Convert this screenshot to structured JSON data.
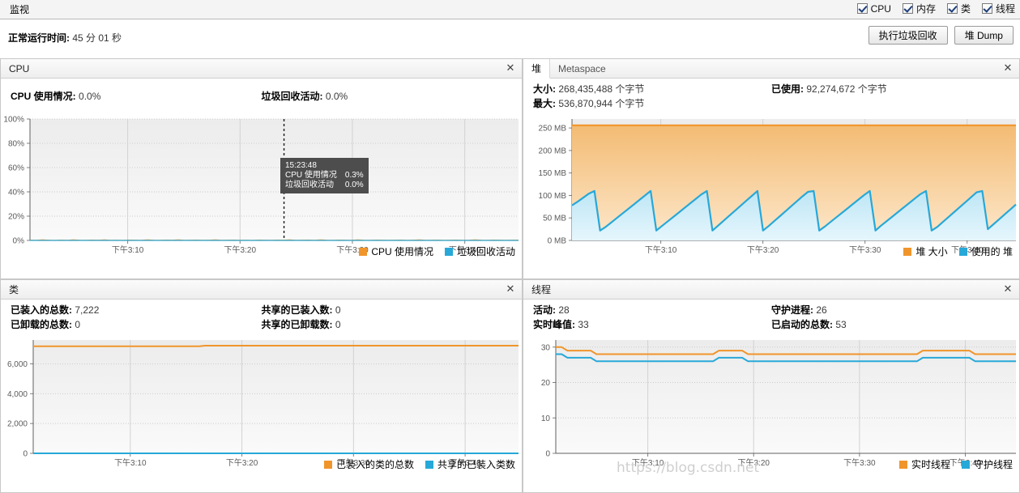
{
  "topbar": {
    "tab_label": "监视",
    "toggles": [
      {
        "label": "CPU",
        "checked": true,
        "name": "cpu"
      },
      {
        "label": "内存",
        "checked": true,
        "name": "memory"
      },
      {
        "label": "类",
        "checked": true,
        "name": "classes"
      },
      {
        "label": "线程",
        "checked": true,
        "name": "threads"
      }
    ]
  },
  "uptime": {
    "label": "正常运行时间:",
    "value": "45 分 01 秒"
  },
  "buttons": {
    "gc": "执行垃圾回收",
    "heap_dump": "堆 Dump"
  },
  "colors": {
    "orange": "#f0952b",
    "orange_fill_top": "#f3bb73",
    "orange_fill_bottom": "#fde8cc",
    "blue": "#28a8d8",
    "blue_fill_top": "#bde6f5",
    "blue_fill_bottom": "#e6f6fd",
    "grid": "#cccccc",
    "axis": "#808080",
    "plot_bg_top": "#ececec",
    "plot_bg_bottom": "#fafafa",
    "tooltip_bg": "#4d4d4d"
  },
  "cpu_panel": {
    "title": "CPU",
    "close": "✕",
    "stats": [
      {
        "label": "CPU 使用情况:",
        "value": "0.0%"
      },
      {
        "label": "垃圾回收活动:",
        "value": "0.0%"
      }
    ],
    "tooltip": {
      "time": "15:23:48",
      "rows": [
        {
          "label": "CPU 使用情况",
          "value": "0.3%"
        },
        {
          "label": "垃圾回收活动",
          "value": "0.0%"
        }
      ]
    }
  },
  "heap_panel": {
    "tabs": [
      {
        "label": "堆",
        "active": true
      },
      {
        "label": "Metaspace",
        "active": false
      }
    ],
    "close": "✕",
    "stats": [
      {
        "label": "大小:",
        "value": "268,435,488 个字节"
      },
      {
        "label": "最大:",
        "value": "536,870,944 个字节"
      },
      {
        "label": "已使用:",
        "value": "92,274,672 个字节"
      }
    ]
  },
  "classes_panel": {
    "title": "类",
    "close": "✕",
    "stats": [
      {
        "label": "已装入的总数:",
        "value": "7,222"
      },
      {
        "label": "已卸载的总数:",
        "value": "0"
      },
      {
        "label": "共享的已装入数:",
        "value": "0"
      },
      {
        "label": "共享的已卸载数:",
        "value": "0"
      }
    ]
  },
  "threads_panel": {
    "title": "线程",
    "close": "✕",
    "stats": [
      {
        "label": "活动:",
        "value": "28"
      },
      {
        "label": "实时峰值:",
        "value": "33"
      },
      {
        "label": "守护进程:",
        "value": "26"
      },
      {
        "label": "已启动的总数:",
        "value": "53"
      }
    ]
  },
  "watermark": "https://blog.csdn.net",
  "chart_data": [
    {
      "id": "cpu",
      "type": "line",
      "title": "CPU",
      "xlabel": "",
      "ylabel": "",
      "grid": true,
      "legend_position": "bottom-right",
      "x_ticks": [
        "下午3:10",
        "下午3:20",
        "下午3:30",
        "下午3:40"
      ],
      "x_tick_positions": [
        0.2,
        0.43,
        0.66,
        0.89
      ],
      "y_ticks": [
        "0%",
        "20%",
        "40%",
        "60%",
        "80%",
        "100%"
      ],
      "ylim": [
        0,
        100
      ],
      "marker_line_x": 0.52,
      "series": [
        {
          "name": "CPU 使用情况",
          "color": "#f0952b",
          "values": [
            0.2,
            0.1,
            0.4,
            0.2,
            0.0,
            0.3,
            0.1,
            0.5,
            0.2,
            0.1,
            0.3,
            0.2,
            0.4,
            0.1,
            0.2,
            0.0,
            0.3,
            0.2,
            0.1,
            0.4,
            0.2,
            0.1,
            0.3,
            0.2,
            0.5,
            0.1,
            0.2,
            0.3,
            0.1,
            0.2,
            0.4,
            0.1,
            0.2,
            0.3,
            0.1,
            0.2,
            0.0,
            0.3,
            0.2,
            0.1,
            0.3,
            0.2,
            0.4,
            0.1,
            0.2,
            0.3,
            0.1,
            0.5,
            0.2,
            0.1,
            0.3,
            0.2,
            0.1,
            0.4,
            0.2,
            0.1,
            0.3,
            0.2,
            0.1,
            0.2,
            0.3,
            0.1,
            0.2,
            0.4,
            0.1,
            0.2,
            0.3,
            0.1,
            0.2,
            0.3,
            0.1,
            0.2,
            0.4,
            0.2,
            0.1,
            0.3,
            0.2,
            0.1,
            0.2,
            0.3
          ]
        },
        {
          "name": "垃圾回收活动",
          "color": "#28a8d8",
          "values": [
            0,
            0,
            0,
            0,
            0,
            0,
            0,
            0,
            0,
            0,
            0,
            0,
            0,
            0,
            0,
            0,
            0,
            0,
            0,
            0,
            0,
            0,
            0,
            0,
            0,
            0,
            0,
            0,
            0,
            0,
            0,
            0,
            0,
            0,
            0,
            0,
            0,
            0,
            0,
            0,
            0,
            0,
            0,
            0,
            0,
            0,
            0,
            0,
            0,
            0,
            0,
            0,
            0,
            0,
            0,
            0,
            0,
            0,
            0,
            0,
            0,
            0,
            0,
            0,
            0,
            0,
            0,
            0,
            0,
            0,
            0,
            0,
            0,
            0,
            0,
            0,
            0,
            0,
            0,
            0
          ]
        }
      ]
    },
    {
      "id": "heap",
      "type": "area",
      "title": "堆",
      "xlabel": "",
      "ylabel": "MB",
      "grid": true,
      "legend_position": "bottom-right",
      "x_ticks": [
        "下午3:10",
        "下午3:20",
        "下午3:30",
        "下午3:40"
      ],
      "x_tick_positions": [
        0.2,
        0.43,
        0.66,
        0.89
      ],
      "y_ticks": [
        "0 MB",
        "50 MB",
        "100 MB",
        "150 MB",
        "200 MB",
        "250 MB"
      ],
      "ylim": [
        0,
        270
      ],
      "series": [
        {
          "name": "堆 大小",
          "color": "#f0952b",
          "values": [
            256,
            256,
            256,
            256,
            256,
            256,
            256,
            256,
            256,
            256,
            256,
            256,
            256,
            256,
            256,
            256,
            256,
            256,
            256,
            256,
            256,
            256,
            256,
            256,
            256,
            256,
            256,
            256,
            256,
            256,
            256,
            256,
            256,
            256,
            256,
            256,
            256,
            256,
            256,
            256,
            256,
            256,
            256,
            256,
            256,
            256,
            256,
            256,
            256,
            256,
            256,
            256,
            256,
            256,
            256,
            256,
            256,
            256,
            256,
            256,
            256,
            256,
            256,
            256,
            256,
            256,
            256,
            256,
            256,
            256,
            256,
            256,
            256,
            256,
            256,
            256,
            256,
            256,
            256,
            256
          ]
        },
        {
          "name": "使用的 堆",
          "color": "#28a8d8",
          "values": [
            78,
            86,
            95,
            104,
            110,
            22,
            30,
            40,
            50,
            60,
            70,
            80,
            90,
            100,
            110,
            22,
            32,
            42,
            52,
            62,
            72,
            82,
            92,
            102,
            110,
            22,
            33,
            44,
            55,
            66,
            77,
            88,
            99,
            110,
            22,
            32,
            43,
            54,
            65,
            76,
            87,
            98,
            108,
            110,
            22,
            31,
            41,
            51,
            61,
            71,
            81,
            91,
            101,
            110,
            22,
            33,
            43,
            53,
            63,
            73,
            83,
            93,
            103,
            110,
            22,
            30,
            41,
            52,
            63,
            74,
            85,
            96,
            107,
            110,
            25,
            36,
            47,
            58,
            69,
            80
          ]
        }
      ]
    },
    {
      "id": "classes",
      "type": "line",
      "title": "类",
      "xlabel": "",
      "ylabel": "",
      "grid": true,
      "legend_position": "bottom-right",
      "x_ticks": [
        "下午3:10",
        "下午3:20",
        "下午3:30",
        "下午3:40"
      ],
      "x_tick_positions": [
        0.2,
        0.43,
        0.66,
        0.89
      ],
      "y_ticks": [
        "0",
        "2,000",
        "4,000",
        "6,000"
      ],
      "ylim": [
        0,
        7600
      ],
      "series": [
        {
          "name": "已装入的类的总数",
          "color": "#f0952b",
          "values": [
            7180,
            7180,
            7180,
            7180,
            7180,
            7180,
            7180,
            7180,
            7180,
            7180,
            7180,
            7180,
            7180,
            7180,
            7180,
            7180,
            7180,
            7180,
            7180,
            7180,
            7180,
            7180,
            7180,
            7180,
            7180,
            7180,
            7180,
            7180,
            7222,
            7222,
            7222,
            7222,
            7222,
            7222,
            7222,
            7222,
            7222,
            7222,
            7222,
            7222,
            7222,
            7222,
            7222,
            7222,
            7222,
            7222,
            7222,
            7222,
            7222,
            7222,
            7222,
            7222,
            7222,
            7222,
            7222,
            7222,
            7222,
            7222,
            7222,
            7222,
            7222,
            7222,
            7222,
            7222,
            7222,
            7222,
            7222,
            7222,
            7222,
            7222,
            7222,
            7222,
            7222,
            7222,
            7222,
            7222,
            7222,
            7222,
            7222,
            7222
          ]
        },
        {
          "name": "共享的已装入类数",
          "color": "#28a8d8",
          "values": [
            0,
            0,
            0,
            0,
            0,
            0,
            0,
            0,
            0,
            0,
            0,
            0,
            0,
            0,
            0,
            0,
            0,
            0,
            0,
            0,
            0,
            0,
            0,
            0,
            0,
            0,
            0,
            0,
            0,
            0,
            0,
            0,
            0,
            0,
            0,
            0,
            0,
            0,
            0,
            0,
            0,
            0,
            0,
            0,
            0,
            0,
            0,
            0,
            0,
            0,
            0,
            0,
            0,
            0,
            0,
            0,
            0,
            0,
            0,
            0,
            0,
            0,
            0,
            0,
            0,
            0,
            0,
            0,
            0,
            0,
            0,
            0,
            0,
            0,
            0,
            0,
            0,
            0,
            0,
            0
          ]
        }
      ]
    },
    {
      "id": "threads",
      "type": "line",
      "title": "线程",
      "xlabel": "",
      "ylabel": "",
      "grid": true,
      "legend_position": "bottom-right",
      "x_ticks": [
        "下午3:10",
        "下午3:20",
        "下午3:30",
        "下午3:40"
      ],
      "x_tick_positions": [
        0.2,
        0.43,
        0.66,
        0.89
      ],
      "y_ticks": [
        "0",
        "10",
        "20",
        "30"
      ],
      "ylim": [
        0,
        32
      ],
      "series": [
        {
          "name": "实时线程",
          "color": "#f0952b",
          "values": [
            30,
            30,
            29,
            29,
            29,
            29,
            29,
            28,
            28,
            28,
            28,
            28,
            28,
            28,
            28,
            28,
            28,
            28,
            28,
            28,
            28,
            28,
            28,
            28,
            28,
            28,
            28,
            28,
            29,
            29,
            29,
            29,
            29,
            28,
            28,
            28,
            28,
            28,
            28,
            28,
            28,
            28,
            28,
            28,
            28,
            28,
            28,
            28,
            28,
            28,
            28,
            28,
            28,
            28,
            28,
            28,
            28,
            28,
            28,
            28,
            28,
            28,
            28,
            29,
            29,
            29,
            29,
            29,
            29,
            29,
            29,
            29,
            28,
            28,
            28,
            28,
            28,
            28,
            28,
            28
          ]
        },
        {
          "name": "守护线程",
          "color": "#28a8d8",
          "values": [
            28,
            28,
            27,
            27,
            27,
            27,
            27,
            26,
            26,
            26,
            26,
            26,
            26,
            26,
            26,
            26,
            26,
            26,
            26,
            26,
            26,
            26,
            26,
            26,
            26,
            26,
            26,
            26,
            27,
            27,
            27,
            27,
            27,
            26,
            26,
            26,
            26,
            26,
            26,
            26,
            26,
            26,
            26,
            26,
            26,
            26,
            26,
            26,
            26,
            26,
            26,
            26,
            26,
            26,
            26,
            26,
            26,
            26,
            26,
            26,
            26,
            26,
            26,
            27,
            27,
            27,
            27,
            27,
            27,
            27,
            27,
            27,
            26,
            26,
            26,
            26,
            26,
            26,
            26,
            26
          ]
        }
      ]
    }
  ]
}
